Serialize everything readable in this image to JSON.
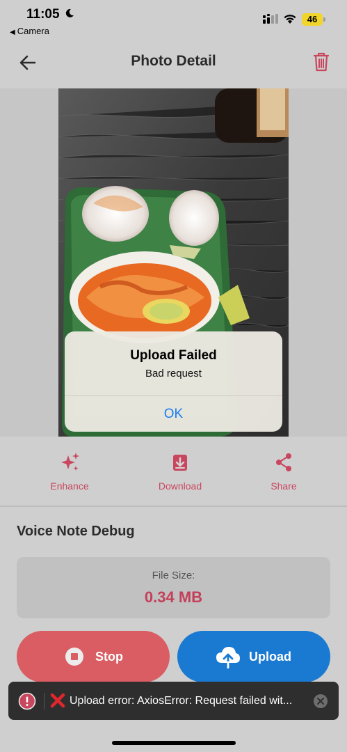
{
  "status_bar": {
    "time": "11:05",
    "back_app": "Camera",
    "battery": "46"
  },
  "header": {
    "title": "Photo Detail",
    "back_icon": "arrow-left-icon",
    "delete_icon": "trash-icon"
  },
  "photo": {
    "description_icon": "food-photo"
  },
  "alert": {
    "title": "Upload Failed",
    "message": "Bad request",
    "ok_label": "OK"
  },
  "actions": [
    {
      "label": "Enhance",
      "icon": "sparkle-icon"
    },
    {
      "label": "Download",
      "icon": "download-icon"
    },
    {
      "label": "Share",
      "icon": "share-icon"
    }
  ],
  "voice_note": {
    "title": "Voice Note Debug",
    "file_size_label": "File Size:",
    "file_size_value": "0.34 MB",
    "stop_label": "Stop",
    "upload_label": "Upload"
  },
  "toast": {
    "message": "Upload error: AxiosError: Request failed wit..."
  },
  "colors": {
    "accent": "#c4405a",
    "stop_button": "#d95d62",
    "upload_button": "#1a79d1",
    "alert_link": "#1a7cf0",
    "battery": "#f2d52a"
  }
}
